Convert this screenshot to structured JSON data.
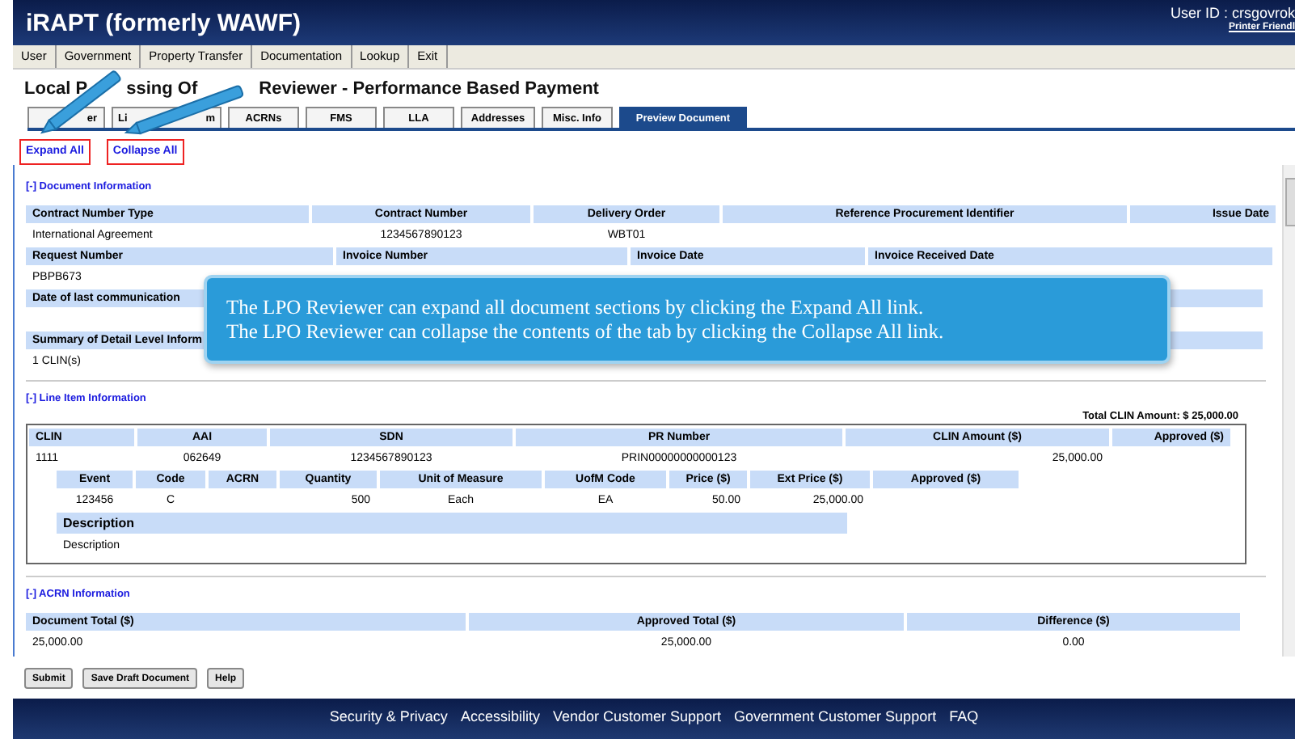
{
  "header": {
    "app_title": "iRAPT (formerly WAWF)",
    "user_id": "User ID :  crsgovrok",
    "printer_link": "Printer Friendl"
  },
  "menu": [
    "User",
    "Government",
    "Property Transfer",
    "Documentation",
    "Lookup",
    "Exit"
  ],
  "page_title": [
    "Local P",
    "ssing Of",
    "Reviewer - Performance Based Payment"
  ],
  "tabs": [
    {
      "label": "er",
      "selected": false
    },
    {
      "label": "Li",
      "label_end": "m",
      "selected": false
    },
    {
      "label": "ACRNs",
      "selected": false
    },
    {
      "label": "FMS",
      "selected": false
    },
    {
      "label": "LLA",
      "selected": false
    },
    {
      "label": "Addresses",
      "selected": false
    },
    {
      "label": "Misc. Info",
      "selected": false
    },
    {
      "label": "Preview Document",
      "selected": true
    }
  ],
  "links": [
    "Expand All",
    "Collapse All"
  ],
  "document_information": {
    "toggle": "[-] Document Information",
    "headers_1": [
      "Contract Number Type",
      "Contract Number",
      "Delivery Order",
      "Reference Procurement Identifier",
      "Issue Date"
    ],
    "values_1": [
      "International Agreement",
      "1234567890123",
      "WBT01"
    ],
    "headers_2": [
      "Request Number",
      "Invoice Number",
      "Invoice Date",
      "Invoice Received Date"
    ],
    "values_2": [
      "PBPB673"
    ],
    "headers_3": [
      "Date of last communication"
    ],
    "headers_4": [
      "Summary of Detail Level Inform"
    ],
    "values_4": [
      "1 CLIN(s)"
    ]
  },
  "line_item_information": {
    "toggle": "[-] Line Item Information",
    "total": "Total CLIN Amount: $  25,000.00",
    "headers": [
      "CLIN",
      "AAI",
      "SDN",
      "PR Number",
      "CLIN Amount ($)",
      "Approved ($)"
    ],
    "values": [
      "1111",
      "062649",
      "1234567890123",
      "PRIN00000000000123",
      "25,000.00"
    ],
    "sub_columns": [
      {
        "header": "Event",
        "value": "123456"
      },
      {
        "header": "Code",
        "value": "C"
      },
      {
        "header": "ACRN"
      },
      {
        "header": "Quantity",
        "value": "500"
      },
      {
        "header": "Unit of Measure",
        "value": "Each"
      },
      {
        "header": "UofM Code",
        "value": "EA"
      },
      {
        "header": "Price ($)",
        "value": "50.00"
      },
      {
        "header": "Ext Price ($)",
        "value": "25,000.00"
      },
      {
        "header": "Approved ($)"
      }
    ],
    "description_header": "Description",
    "description": "Description"
  },
  "acrn_information": {
    "toggle": "[-] ACRN Information",
    "headers": [
      "Document Total ($)",
      "Approved Total ($)",
      "Difference ($)"
    ],
    "values": [
      "25,000.00",
      "25,000.00",
      "0.00"
    ]
  },
  "buttons": [
    "Submit",
    "Save Draft Document",
    "Help"
  ],
  "footer": [
    "Security & Privacy",
    "Accessibility",
    "Vendor Customer Support",
    "Government Customer Support",
    "FAQ"
  ],
  "callout": [
    "The LPO Reviewer can expand all document sections by clicking the Expand All link.",
    "The LPO Reviewer can collapse the contents of the tab by clicking the Collapse All link."
  ]
}
